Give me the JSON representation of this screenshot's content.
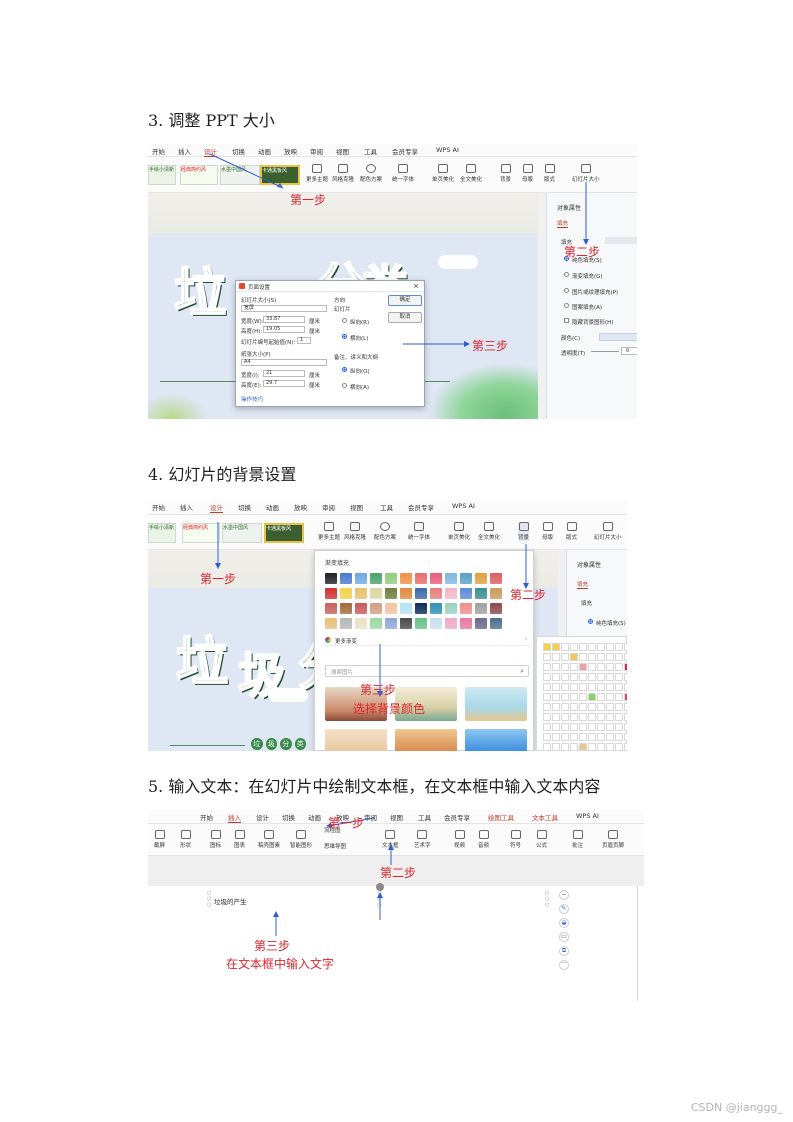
{
  "headings": {
    "h3": "3.  调整 PPT 大小",
    "h4": "4.  幻灯片的背景设置",
    "h5": "5.  输入文本：在幻灯片中绘制文本框，在文本框中输入文本内容"
  },
  "menu_tabs": {
    "a": [
      "开始",
      "插入",
      "设计",
      "切换",
      "动画",
      "放映",
      "审阅",
      "视图",
      "工具",
      "会员专享",
      "WPS AI"
    ],
    "b": [
      "开始",
      "插入",
      "设计",
      "切换",
      "动画",
      "放映",
      "审阅",
      "视图",
      "工具",
      "会员专享",
      "WPS AI"
    ],
    "c": [
      "开始",
      "插入",
      "设计",
      "切换",
      "动画",
      "放映",
      "审阅",
      "视图",
      "工具",
      "会员专享",
      "绘图工具",
      "文本工具",
      "WPS AI"
    ]
  },
  "toolbar_a": [
    "更多主题",
    "风格克隆",
    "配色方案",
    "统一字体",
    "单页美化",
    "全文美化",
    "背景",
    "母版",
    "版式",
    "幻灯片大小"
  ],
  "toolbar_b": [
    "更多主题",
    "风格克隆",
    "配色方案",
    "统一字体",
    "单页美化",
    "全文美化",
    "背景",
    "母版",
    "版式",
    "幻灯片大小"
  ],
  "toolbar_c": [
    "形状",
    "图标",
    "图表",
    "稿壳图素",
    "智能图形",
    "流程图",
    "思维导图",
    "文本框",
    "艺术字",
    "视频",
    "音频",
    "符号",
    "公式",
    "批注",
    "页眉页脚"
  ],
  "themes": {
    "a": [
      "手绘小清新",
      "经典简约风",
      "水墨中国风",
      "卡通黑板风"
    ],
    "b": [
      "手绘小清新",
      "经典简约风",
      "水墨中国风",
      "卡通黑板风"
    ]
  },
  "slide_chars": {
    "a": [
      "垃",
      "分",
      "类"
    ],
    "b": [
      "垃",
      "圾",
      "分"
    ],
    "badge": [
      "垃",
      "圾",
      "分",
      "类"
    ]
  },
  "steps": {
    "a1": "第一步",
    "a2": "第二步",
    "a3": "第三步",
    "b1": "第一步",
    "b2": "第二步",
    "b3": "第三步",
    "b3_sub": "选择背景颜色",
    "c1": "第一步",
    "c2": "第二步",
    "c3": "第三步",
    "c3_sub": "在文本框中输入文字"
  },
  "dialog": {
    "title": "页面设置",
    "slide_size_label": "幻灯片大小(S)",
    "slide_size_value": "宽屏",
    "width_label": "宽度(W):",
    "width_value": "33.87",
    "height_label": "高度(H):",
    "height_value": "19.05",
    "unit": "厘米",
    "start_num_label": "幻灯片编号起始值(N):",
    "start_num_value": "1",
    "paper_label": "纸张大小(P)",
    "paper_value": "A4",
    "paper_width_label": "宽度(I):",
    "paper_width_value": "21",
    "paper_height_label": "高度(E):",
    "paper_height_value": "29.7",
    "orientation_label": "方向",
    "slides_label": "幻灯片",
    "portrait": "纵向(R)",
    "landscape": "横向(L)",
    "notes_label": "备注、讲义和大纲",
    "notes_portrait": "纵向(O)",
    "notes_landscape": "横向(A)",
    "ok": "确定",
    "cancel": "取消",
    "tips": "操作技巧"
  },
  "panel_a": {
    "title": "对象属性",
    "tab": "填充",
    "section": "填充",
    "options": [
      "纯色填充(S)",
      "渐变填充(G)",
      "图片或纹理填充(P)",
      "图案填充(A)",
      "隐藏背景图形(H)"
    ],
    "color_label": "颜色(C)",
    "transparency_label": "透明度(T)",
    "transparency_value": "0"
  },
  "panel_b": {
    "title": "对象属性",
    "tab": "填充",
    "section": "填充",
    "option": "纯色填充(S)"
  },
  "gradient_popup": {
    "title": "渐变填充",
    "more": "更多渐变",
    "search_placeholder": "搜索图片"
  },
  "colors": {
    "accent_red": "#e0242c",
    "arrow_blue": "#2f5fd0",
    "slide_green": "#2d6c3d",
    "swatches": [
      "#222222",
      "#4a7bd0",
      "#6ea8e6",
      "#4aa36a",
      "#8fcf7a",
      "#f0914a",
      "#e66e6e",
      "#e85b7a",
      "#7fb8e0",
      "#5aa0c8",
      "#e0a040",
      "#d86060",
      "#d03030",
      "#f2d24a",
      "#e8c070",
      "#d9d6a0",
      "#6f7f3a",
      "#e08a40",
      "#3a6aa8",
      "#e67e7e",
      "#f1b6c6",
      "#5d8ad6",
      "#3a8f8f",
      "#c89b5a",
      "#c96060",
      "#a46a3a",
      "#c85a5a",
      "#d0a080",
      "#f2c2a0",
      "#b6e2f2",
      "#0c2b5c",
      "#2f8fb5",
      "#9ad0c0",
      "#f08c8c",
      "#a0a0a0",
      "#8b4b4b",
      "#e6c07a",
      "#b7b7b7",
      "#e8e0c8",
      "#9ad8a0",
      "#8ea6d8",
      "#4a4a4a",
      "#6ac08a",
      "#c8e0f0",
      "#f0a8c8",
      "#e878a0",
      "#6a6a8a",
      "#4d6f8f"
    ]
  },
  "text_box_content": "垃圾的产生",
  "watermark": "CSDN @jianggg_"
}
